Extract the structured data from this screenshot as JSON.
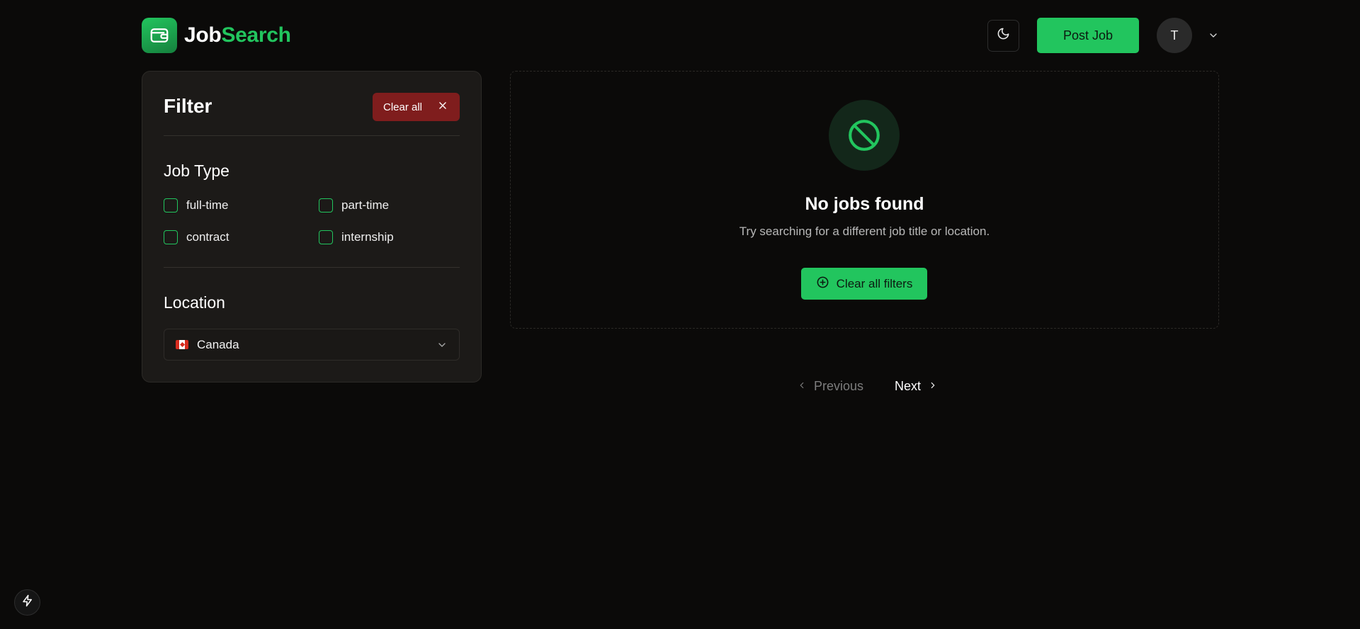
{
  "header": {
    "brand_job": "Job",
    "brand_search": "Search",
    "post_job_label": "Post Job",
    "avatar_initial": "T",
    "icons": {
      "logo": "wallet-icon",
      "theme": "moon-icon",
      "menu": "chevron-down-icon"
    }
  },
  "filter": {
    "title": "Filter",
    "clear_all_label": "Clear all",
    "job_type": {
      "heading": "Job Type",
      "options": [
        {
          "label": "full-time",
          "checked": false
        },
        {
          "label": "part-time",
          "checked": false
        },
        {
          "label": "contract",
          "checked": false
        },
        {
          "label": "internship",
          "checked": false
        }
      ]
    },
    "location": {
      "heading": "Location",
      "selected": "Canada",
      "flag": "canada-flag"
    }
  },
  "results": {
    "empty_title": "No jobs found",
    "empty_subtitle": "Try searching for a different job title or location.",
    "clear_filters_label": "Clear all filters",
    "icon": "ban-icon"
  },
  "pagination": {
    "previous_label": "Previous",
    "next_label": "Next",
    "previous_disabled": true
  },
  "colors": {
    "background": "#0b0a09",
    "panel": "#1c1a18",
    "accent": "#22c55e",
    "danger": "#7f1d1d"
  }
}
